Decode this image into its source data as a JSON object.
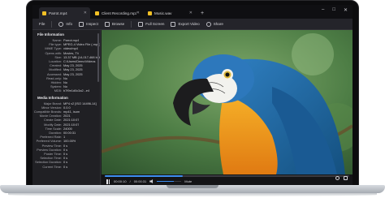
{
  "tabs": [
    {
      "label": "Parrot.mp4",
      "active": true
    },
    {
      "label": "Client Recording.mp3",
      "active": false
    },
    {
      "label": "Music.wav",
      "active": false
    }
  ],
  "newtab_symbol": "+",
  "window_buttons": [
    "–",
    "□",
    "✕"
  ],
  "toolbar": {
    "file": "File",
    "info": "Info",
    "inspect": "Inspect",
    "browse": "Browse",
    "full_screen": "Full Screen",
    "export_video": "Export Video",
    "share": "Share"
  },
  "sidebar": {
    "file_info_title": "File Information",
    "file_info": [
      {
        "k": "Name:",
        "v": "Parrot.mp4"
      },
      {
        "k": "File type:",
        "v": "MPEG-4 Video File (.mp4)"
      },
      {
        "k": "MIME Type:",
        "v": "video/mp4"
      },
      {
        "k": "Opens with:",
        "v": "Movies, TV"
      },
      {
        "k": "Size:",
        "v": "13.37 MB (14,017,468 bytes)"
      },
      {
        "k": "Location:",
        "v": "C:\\Users\\Demo\\Videos"
      },
      {
        "k": "Created:",
        "v": "May 23, 2025"
      },
      {
        "k": "Modified:",
        "v": "May 23, 2025"
      },
      {
        "k": "Accessed:",
        "v": "May 23, 2025"
      },
      {
        "k": "Read-only:",
        "v": "No"
      },
      {
        "k": "Hidden:",
        "v": "No"
      },
      {
        "k": "System:",
        "v": "No"
      },
      {
        "k": "MD5:",
        "v": "b7f9e1d0c3a2...e4"
      }
    ],
    "media_info_title": "Media Information",
    "media_info": [
      {
        "k": "Major Brand:",
        "v": "MP4 v2 [ISO 14496-14]"
      },
      {
        "k": "Minor Version:",
        "v": "0.0.0"
      },
      {
        "k": "Compatible Brands:",
        "v": "mp41, isom"
      },
      {
        "k": "Movie Creation:",
        "v": "2021"
      },
      {
        "k": "Create Date:",
        "v": "2021:10:07"
      },
      {
        "k": "Modify Date:",
        "v": "2021:10:07"
      },
      {
        "k": "Time Scale:",
        "v": "24000"
      },
      {
        "k": "Duration:",
        "v": "00:00:31"
      },
      {
        "k": "Preferred Rate:",
        "v": "1"
      },
      {
        "k": "Preferred Volume:",
        "v": "100.00%"
      },
      {
        "k": "Preview Time:",
        "v": "0 s"
      },
      {
        "k": "Preview Duration:",
        "v": "0 s"
      },
      {
        "k": "Poster Time:",
        "v": "0 s"
      },
      {
        "k": "Selection Time:",
        "v": "0 s"
      },
      {
        "k": "Selection Duration:",
        "v": "0 s"
      },
      {
        "k": "Current Time:",
        "v": "0 s"
      }
    ]
  },
  "player": {
    "current_time": "00:00:10",
    "duration": "00:00:31",
    "progress": 0.32,
    "volume": 0.7,
    "mute_label": "Mute"
  }
}
